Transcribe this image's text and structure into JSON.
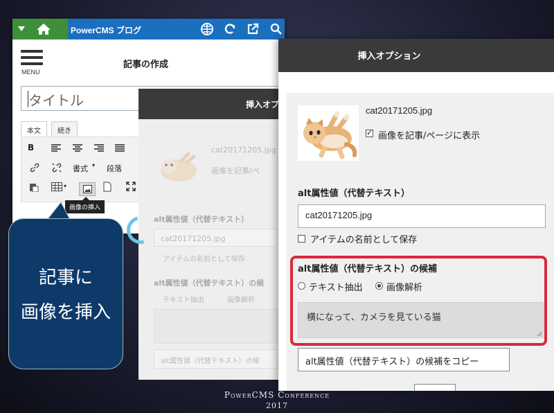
{
  "app": {
    "title": "PowerCMS ブログ"
  },
  "editor": {
    "menu_label": "MENU",
    "page_title": "記事の作成",
    "title_placeholder": "タイトル",
    "tabs": [
      {
        "label": "本文"
      },
      {
        "label": "続き"
      }
    ],
    "toolbar": {
      "bold_label": "B",
      "format_label": "書式",
      "paragraph_label": "段落",
      "insert_image_tooltip": "画像の挿入"
    }
  },
  "background_dialog": {
    "title": "挿入オプ",
    "filename": "cat20171205.jpg",
    "show_label": "画像を記事/ペ",
    "alt_heading": "alt属性値（代替テキスト）",
    "alt_value": "cat20171205.jpg",
    "save_label": "アイテムの名前として保存",
    "candidate_heading": "alt属性値（代替テキスト）の候",
    "radio_text": "テキスト抽出",
    "radio_image": "画像解析",
    "copy_label": "alt属性値（代替テキスト）の候"
  },
  "dialog": {
    "title": "挿入オプション",
    "filename": "cat20171205.jpg",
    "show_in_post_label": "画像を記事/ページに表示",
    "show_in_post_checked": true,
    "alt_heading": "alt属性値（代替テキスト）",
    "alt_value": "cat20171205.jpg",
    "save_as_name_label": "アイテムの名前として保存",
    "save_as_name_checked": false,
    "candidate_heading": "alt属性値（代替テキスト）の候補",
    "radio_text_extract": "テキスト抽出",
    "radio_image_analysis": "画像解析",
    "selected_method": "画像解析",
    "candidate_text": "横になって、カメラを見ている猫",
    "copy_button": "alt属性値（代替テキスト）の候補をコピー"
  },
  "callout": {
    "line1": "記事に",
    "line2": "画像を挿入"
  },
  "footer": {
    "line1": "PowerCMS Conference",
    "line2": "2017"
  },
  "colors": {
    "topbar_blue": "#1b6fbf",
    "home_green": "#3d8f3a",
    "dialog_header": "#3a3a3a",
    "highlight_red": "#d82a3a",
    "callout_navy": "#0e3a6a"
  },
  "icons": [
    "home-icon",
    "grid-icon",
    "refresh-icon",
    "external-link-icon",
    "search-icon",
    "menu-icon",
    "link-icon",
    "unlink-icon",
    "paste-icon",
    "table-icon",
    "image-icon",
    "document-icon",
    "fullscreen-icon",
    "cat-photo"
  ]
}
